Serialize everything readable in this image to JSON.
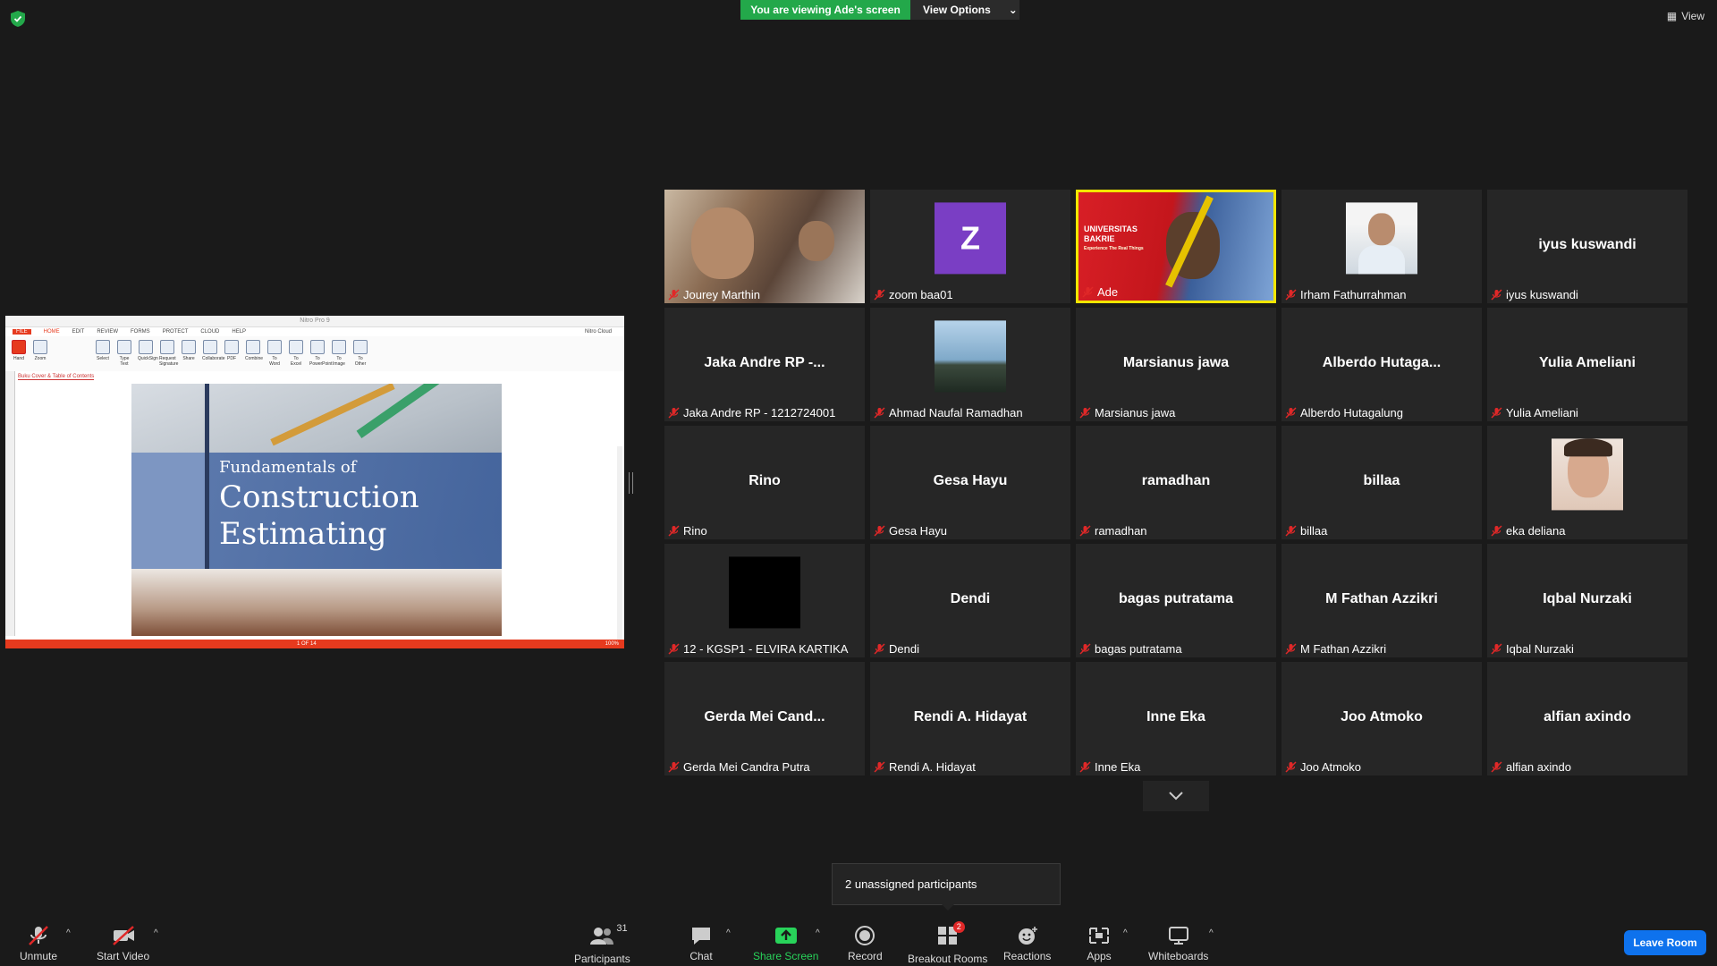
{
  "top": {
    "banner": "You are viewing Ade's screen",
    "view_options": "View Options",
    "view": "View"
  },
  "share": {
    "app_title": "Nitro Pro 9",
    "tabs": [
      "FILE",
      "HOME",
      "EDIT",
      "REVIEW",
      "FORMS",
      "PROTECT",
      "CLOUD",
      "HELP"
    ],
    "nitro_cloud": "Nitro Cloud",
    "tools": [
      "Hand",
      "Zoom",
      "Select",
      "Type Text",
      "QuickSign",
      "Request Signature",
      "Share",
      "Collaborate",
      "PDF",
      "Combine",
      "To Word",
      "To Excel",
      "To PowerPoint",
      "To Image",
      "To Other"
    ],
    "doc_tab": "Buku Cover & Table of Contents",
    "cover_subtitle": "Fundamentals of",
    "cover_title_line1": "Construction",
    "cover_title_line2": "Estimating",
    "page_indicator": "1 OF 14",
    "zoom": "100%"
  },
  "participants": [
    {
      "label": "Jourey Marthin",
      "video": "photo",
      "color": "#8a6b52"
    },
    {
      "label": "zoom baa01",
      "avatar_letter": "Z",
      "video": "avatar"
    },
    {
      "label": "Ade",
      "video": "presenter",
      "active": true
    },
    {
      "label": "Irham Fathurrahman",
      "video": "portrait"
    },
    {
      "label": "iyus kuswandi",
      "big": "iyus kuswandi"
    },
    {
      "label": "Jaka Andre RP - 1212724001",
      "big": "Jaka Andre RP -..."
    },
    {
      "label": "Ahmad Naufal Ramadhan",
      "video": "landscape"
    },
    {
      "label": "Marsianus jawa",
      "big": "Marsianus jawa"
    },
    {
      "label": "Alberdo Hutagalung",
      "big": "Alberdo  Hutaga..."
    },
    {
      "label": "Yulia Ameliani",
      "big": "Yulia Ameliani"
    },
    {
      "label": "Rino",
      "big": "Rino"
    },
    {
      "label": "Gesa Hayu",
      "big": "Gesa Hayu"
    },
    {
      "label": "ramadhan",
      "big": "ramadhan"
    },
    {
      "label": "billaa",
      "big": "billaa"
    },
    {
      "label": "eka deliana",
      "video": "selfie"
    },
    {
      "label": "12 - KGSP1 - ELVIRA KARTIKA",
      "video": "black"
    },
    {
      "label": "Dendi",
      "big": "Dendi"
    },
    {
      "label": "bagas putratama",
      "big": "bagas putratama"
    },
    {
      "label": "M Fathan Azzikri",
      "big": "M Fathan Azzikri"
    },
    {
      "label": "Iqbal Nurzaki",
      "big": "Iqbal Nurzaki"
    },
    {
      "label": "Gerda Mei Candra Putra",
      "big": "Gerda  Mei  Cand..."
    },
    {
      "label": "Rendi A. Hidayat",
      "big": "Rendi A. Hidayat"
    },
    {
      "label": "Inne Eka",
      "big": "Inne Eka"
    },
    {
      "label": "Joo Atmoko",
      "big": "Joo Atmoko"
    },
    {
      "label": "alfian axindo",
      "big": "alfian axindo"
    }
  ],
  "presenter_slide": {
    "line1": "UNIVERSITAS",
    "line2": "BAKRIE",
    "line3": "Experience The Real Things"
  },
  "unassigned": "2 unassigned participants",
  "toolbar": {
    "unmute": "Unmute",
    "start_video": "Start Video",
    "participants": "Participants",
    "participants_count": "31",
    "chat": "Chat",
    "share_screen": "Share Screen",
    "record": "Record",
    "breakout_rooms": "Breakout Rooms",
    "breakout_badge": "2",
    "reactions": "Reactions",
    "apps": "Apps",
    "whiteboards": "Whiteboards",
    "leave_room": "Leave Room"
  }
}
